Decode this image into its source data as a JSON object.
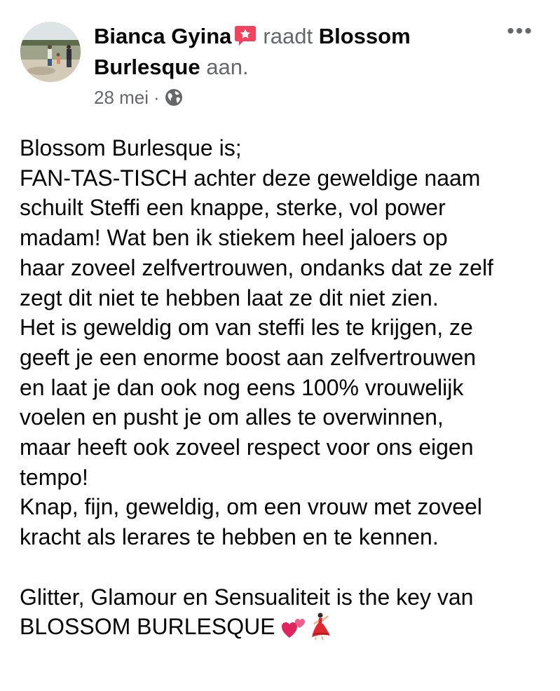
{
  "post": {
    "author": "Bianca Gyina",
    "verb": "raadt",
    "page_name": "Blossom Burlesque",
    "suffix": "aan.",
    "date": "28 mei",
    "separator": "·",
    "privacy_icon": "globe-icon",
    "recommend_icon": "recommendation-icon",
    "more_icon": "more-options-icon",
    "more_label": "•••",
    "body_lines": [
      "Blossom Burlesque is;",
      "FAN-TAS-TISCH achter deze geweldige naam",
      "schuilt Steffi een knappe, sterke, vol power",
      "madam! Wat ben ik stiekem heel jaloers op",
      "haar zoveel zelfvertrouwen, ondanks dat ze zelf",
      "zegt dit niet te hebben laat ze dit niet zien.",
      "Het is geweldig om van steffi les te krijgen, ze",
      "geeft je een enorme boost aan zelfvertrouwen",
      "en laat je dan ook nog eens 100% vrouwelijk",
      "voelen en pusht je om alles te overwinnen,",
      "maar heeft ook zoveel respect voor ons eigen",
      "tempo!",
      "Knap, fijn, geweldig, om een vrouw met zoveel",
      "kracht als lerares te hebben en te kennen.",
      "",
      "Glitter, Glamour en Sensualiteit is the key van",
      "BLOSSOM BURLESQUE"
    ],
    "trailing_emojis": [
      "two-hearts-icon",
      "dancer-icon"
    ]
  },
  "colors": {
    "text": "#050505",
    "secondary_text": "#65676b",
    "recommend_badge": "#f3425f"
  }
}
